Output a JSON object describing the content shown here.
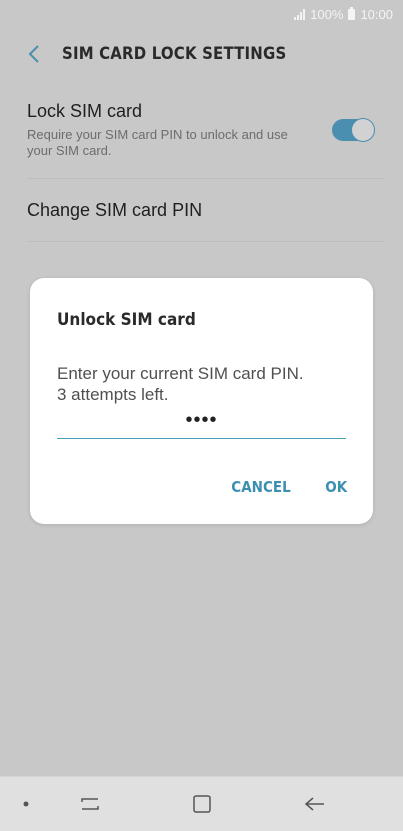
{
  "status_bar": {
    "battery_percent": "100%",
    "time": "10:00"
  },
  "header": {
    "title": "SIM CARD LOCK SETTINGS"
  },
  "settings": {
    "lock_sim": {
      "title": "Lock SIM card",
      "description": "Require your SIM card PIN to unlock and use your SIM card.",
      "enabled": true
    },
    "change_pin": {
      "title": "Change SIM card PIN"
    }
  },
  "dialog": {
    "title": "Unlock SIM card",
    "message_line1": "Enter your current SIM card PIN.",
    "message_line2": "3 attempts left.",
    "pin_value": "••••",
    "cancel_label": "CANCEL",
    "ok_label": "OK"
  },
  "colors": {
    "accent": "#4a8fb0",
    "dim_background": "#c8c8c8",
    "dialog_background": "#ffffff",
    "nav_background": "#e0e0e0"
  }
}
